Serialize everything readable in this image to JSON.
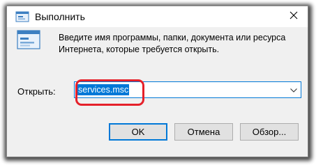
{
  "window": {
    "title": "Выполнить",
    "description": "Введите имя программы, папки, документа или ресурса Интернета, которые требуется открыть."
  },
  "form": {
    "open_label": "Открыть:",
    "input_value": "services.msc"
  },
  "buttons": {
    "ok": "OK",
    "cancel": "Отмена",
    "browse": "Обзор..."
  },
  "icons": {
    "title_icon": "run-dialog-icon",
    "big_icon": "run-dialog-icon",
    "close": "close-icon",
    "dropdown": "chevron-down-icon"
  },
  "colors": {
    "accent": "#0078d7",
    "highlight": "#e5202a"
  }
}
